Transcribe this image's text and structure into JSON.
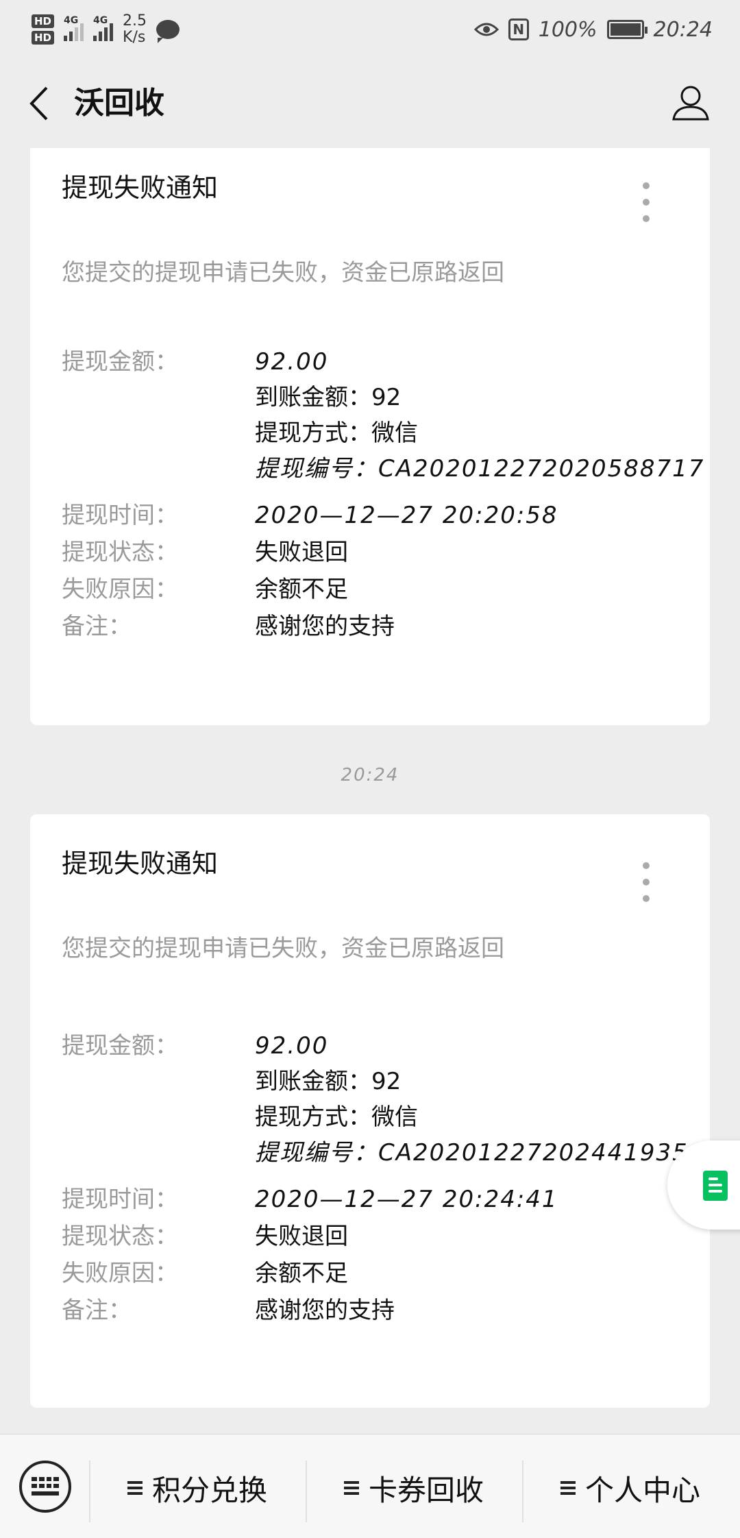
{
  "status_bar": {
    "hd1": "HD",
    "hd2": "HD",
    "net1": "4G",
    "net2": "4G",
    "speed_value": "2.5",
    "speed_unit": "K/s",
    "nfc": "N",
    "battery": "100%",
    "time": "20:24"
  },
  "header": {
    "title": "沃回收"
  },
  "cards": [
    {
      "title": "提现失败通知",
      "desc": "您提交的提现申请已失败，资金已原路返回",
      "amount_label": "提现金额：",
      "amount_value": "92.00",
      "arrival_line": "到账金额：92",
      "method_line": "提现方式：微信",
      "number_line": "提现编号：CA20201227202058871​7",
      "time_label": "提现时间：",
      "time_value": "2020—12—27  20:20:58",
      "status_label": "提现状态：",
      "status_value": "失败退回",
      "reason_label": "失败原因：",
      "reason_value": "余额不足",
      "note_label": "备注：",
      "note_value": "感谢您的支持"
    },
    {
      "title": "提现失败通知",
      "desc": "您提交的提现申请已失败，资金已原路返回",
      "amount_label": "提现金额：",
      "amount_value": "92.00",
      "arrival_line": "到账金额：92",
      "method_line": "提现方式：微信",
      "number_line": "提现编号：CA20201227202441935​6",
      "time_label": "提现时间：",
      "time_value": "2020—12—27  20:24:41",
      "status_label": "提现状态：",
      "status_value": "失败退回",
      "reason_label": "失败原因：",
      "reason_value": "余额不足",
      "note_label": "备注：",
      "note_value": "感谢您的支持"
    }
  ],
  "timestamp": "20:24",
  "bottom_menu": {
    "items": [
      "积分兑换",
      "卡券回收",
      "个人中心"
    ]
  },
  "colors": {
    "background": "#ededed",
    "card": "#ffffff",
    "accent_green": "#07c160",
    "muted_text": "#9a9a9a"
  }
}
